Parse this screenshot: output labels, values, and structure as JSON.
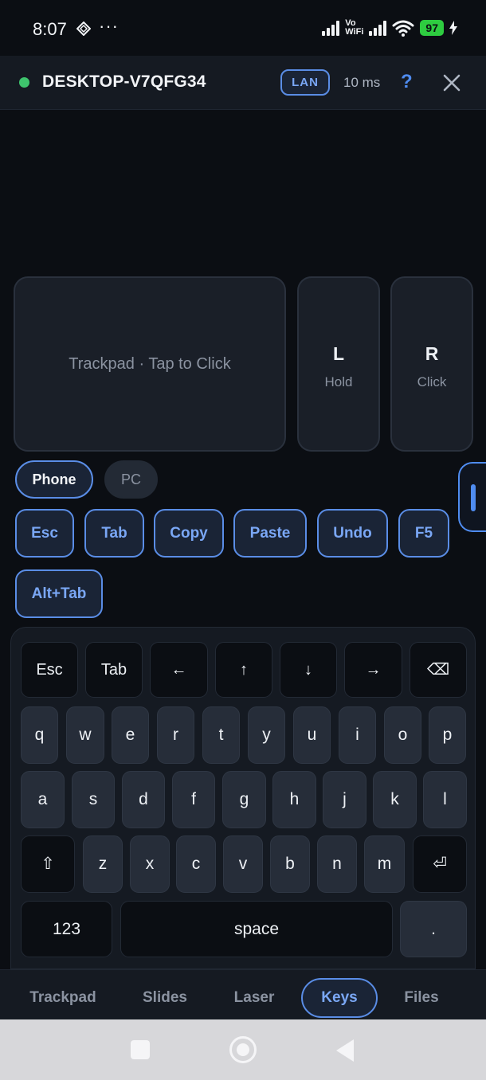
{
  "status_bar": {
    "time": "8:07",
    "dots": "···",
    "vo": "Vo",
    "wifi_label": "WiFi",
    "battery": "97"
  },
  "header": {
    "status_color": "#3ec46d",
    "device_name": "DESKTOP-V7QFG34",
    "connection": "LAN",
    "latency": "10 ms",
    "help": "?"
  },
  "trackpad": {
    "hint": "Trackpad · Tap to Click",
    "left_button": {
      "label": "L",
      "sub": "Hold"
    },
    "right_button": {
      "label": "R",
      "sub": "Click"
    }
  },
  "mode_toggle": {
    "options": [
      "Phone",
      "PC"
    ],
    "selected": "Phone"
  },
  "shortcuts": [
    "Esc",
    "Tab",
    "Copy",
    "Paste",
    "Undo",
    "F5",
    "Alt+Tab"
  ],
  "keyboard": {
    "row1": [
      "Esc",
      "Tab",
      "←",
      "↑",
      "↓",
      "→",
      "⌫"
    ],
    "row2": [
      "q",
      "w",
      "e",
      "r",
      "t",
      "y",
      "u",
      "i",
      "o",
      "p"
    ],
    "row3": [
      "a",
      "s",
      "d",
      "f",
      "g",
      "h",
      "j",
      "k",
      "l"
    ],
    "row4": [
      "⇧",
      "z",
      "x",
      "c",
      "v",
      "b",
      "n",
      "m",
      "⏎"
    ],
    "row5": [
      "123",
      "space",
      "."
    ]
  },
  "bottom_nav": {
    "tabs": [
      "Trackpad",
      "Slides",
      "Laser",
      "Keys",
      "Files"
    ],
    "active": "Keys"
  },
  "colors": {
    "accent": "#5a8de6",
    "accent_text": "#7aa7f5",
    "background": "#0b0e13",
    "battery": "#2ecc40"
  }
}
